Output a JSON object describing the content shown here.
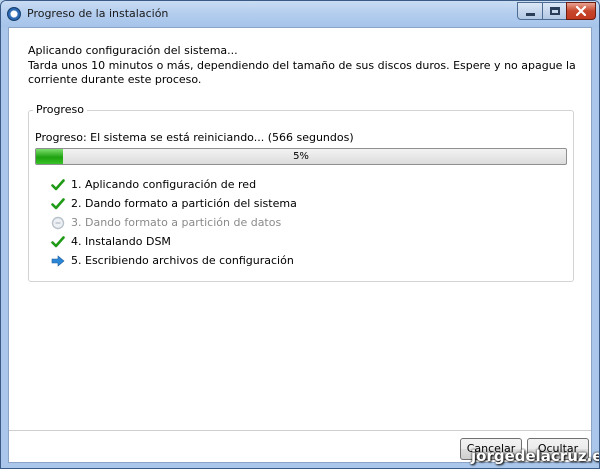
{
  "window": {
    "title": "Progreso de la instalación"
  },
  "intro": {
    "heading": "Aplicando configuración del sistema...",
    "description": "Tarda unos 10 minutos o más, dependiendo del tamaño de sus discos duros. Espere y no apague la corriente durante este proceso."
  },
  "progress_group": {
    "legend": "Progreso",
    "status": "Progreso: El sistema se está reiniciando... (566 segundos)",
    "bar_label": "5%",
    "fraction": 0.05
  },
  "steps": [
    {
      "label": "1. Aplicando configuración de red",
      "state": "done",
      "icon": "check-icon"
    },
    {
      "label": "2. Dando formato a partición del sistema",
      "state": "done",
      "icon": "check-icon"
    },
    {
      "label": "3. Dando formato a partición de datos",
      "state": "pending",
      "icon": "pending-icon"
    },
    {
      "label": "4. Instalando DSM",
      "state": "done",
      "icon": "check-icon"
    },
    {
      "label": "5. Escribiendo archivos de configuración",
      "state": "current",
      "icon": "arrow-right-icon"
    }
  ],
  "buttons": {
    "cancel": "Cancelar",
    "hide": "Ocultar"
  },
  "watermark": "jorgedelacruz.es",
  "colors": {
    "check": "#1f9a16",
    "arrow": "#2b86d6",
    "pending": "#b9c2cc",
    "progress": "#1ea20f"
  }
}
